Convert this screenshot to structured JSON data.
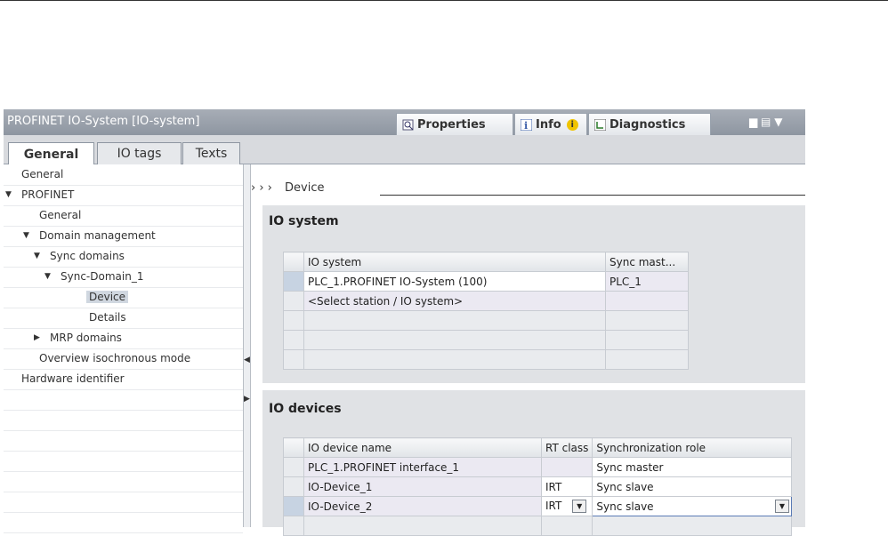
{
  "window": {
    "title": "PROFINET IO-System [IO-system]",
    "tabs": [
      {
        "label": "Properties",
        "icon": "properties-icon"
      },
      {
        "label": "Info",
        "icon": "info-icon"
      },
      {
        "label": "Diagnostics",
        "icon": "diagnostics-icon"
      }
    ],
    "controls": "▆ ▤ ▼"
  },
  "subtabs": [
    "General",
    "IO tags",
    "Texts"
  ],
  "nav": [
    {
      "label": "General",
      "level": 0
    },
    {
      "label": "PROFINET",
      "level": 0,
      "expander": "▼"
    },
    {
      "label": "General",
      "level": 1
    },
    {
      "label": "Domain management",
      "level": 1,
      "expander": "▼"
    },
    {
      "label": "Sync domains",
      "level": 2,
      "expander": "▼"
    },
    {
      "label": "Sync-Domain_1",
      "level": 3,
      "expander": "▼"
    },
    {
      "label": "Device",
      "level": 4,
      "selected": true
    },
    {
      "label": "Details",
      "level": 4
    },
    {
      "label": "MRP domains",
      "level": 2,
      "expander": "▶"
    },
    {
      "label": "Overview isochronous mode",
      "level": 1
    },
    {
      "label": "Hardware identifier",
      "level": 0
    }
  ],
  "breadcrumb": {
    "arrows": "› › ›",
    "label": "Device"
  },
  "io_system": {
    "title": "IO system",
    "columns": [
      "IO system",
      "Sync mast..."
    ],
    "rows": [
      [
        "PLC_1.PROFINET IO-System (100)",
        "PLC_1"
      ],
      [
        "<Select station / IO system>",
        ""
      ]
    ]
  },
  "io_devices": {
    "title": "IO devices",
    "columns": [
      "IO device name",
      "RT class",
      "Synchronization role"
    ],
    "rows": [
      [
        "PLC_1.PROFINET interface_1",
        "",
        "Sync master"
      ],
      [
        "IO-Device_1",
        "IRT",
        "Sync slave"
      ],
      [
        "IO-Device_2",
        "IRT",
        "Sync slave"
      ]
    ]
  }
}
